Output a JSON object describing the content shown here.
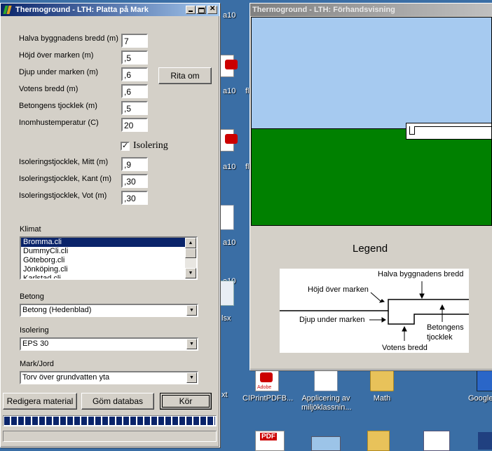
{
  "main_window": {
    "title": "Thermoground - LTH: Platta på Mark",
    "fields": [
      {
        "label": "Halva byggnadens bredd (m)",
        "value": "7"
      },
      {
        "label": "Höjd över marken (m)",
        "value": ",5"
      },
      {
        "label": "Djup under marken (m)",
        "value": ",6"
      },
      {
        "label": "Votens bredd (m)",
        "value": ",6"
      },
      {
        "label": "Betongens tjocklek (m)",
        "value": ",5"
      },
      {
        "label": "Inomhustemperatur (C)",
        "value": "20"
      }
    ],
    "draw_button": "Rita om",
    "insulation_checkbox": {
      "label": "Isolering",
      "checked": "✓"
    },
    "insulation_fields": [
      {
        "label": "Isoleringstjocklek, Mitt (m)",
        "value": ",9"
      },
      {
        "label": "Isoleringstjocklek, Kant (m)",
        "value": ",30"
      },
      {
        "label": "Isoleringstjocklek, Vot (m)",
        "value": ",30"
      }
    ],
    "climate": {
      "label": "Klimat",
      "items": [
        "Bromma.cli",
        "DummyCli.cli",
        "Göteborg.cli",
        "Jönköping.cli",
        "Karlstad.cli"
      ],
      "selected_index": 0
    },
    "concrete": {
      "label": "Betong",
      "value": "Betong (Hedenblad)"
    },
    "insulation": {
      "label": "Isolering",
      "value": "EPS 30"
    },
    "soil": {
      "label": "Mark/Jord",
      "value": "Torv över grundvatten yta"
    },
    "buttons": {
      "edit": "Redigera material",
      "hide_db": "Göm databas",
      "run": "Kör"
    },
    "progress_percent": 100
  },
  "preview_window": {
    "title": "Thermoground - LTH: Förhandsvisning",
    "legend_title": "Legend",
    "legend_labels": {
      "half_width": "Halva byggnadens bredd",
      "height": "Höjd över marken",
      "depth": "Djup under marken",
      "concrete": "Betongens tjocklek",
      "footing": "Votens bredd"
    },
    "colors": {
      "sky": "#a6caf0",
      "ground": "#008000",
      "slab": "#ffffff"
    }
  },
  "desktop": {
    "fragments": [
      "a10",
      "a10",
      "fl",
      "a10",
      "fl",
      "a10",
      "a10",
      "lsx",
      "xt"
    ],
    "icons": [
      {
        "label": "CIPrintPDFB...",
        "icon": "adobe-pdf-icon"
      },
      {
        "label": "Applicering av miljöklassnin...",
        "icon": "document-icon"
      },
      {
        "label": "Math",
        "icon": "folder-icon"
      },
      {
        "label": "Google",
        "icon": "chrome-icon"
      }
    ],
    "adobe_text": "Adobe",
    "pdf_text": "PDF"
  }
}
